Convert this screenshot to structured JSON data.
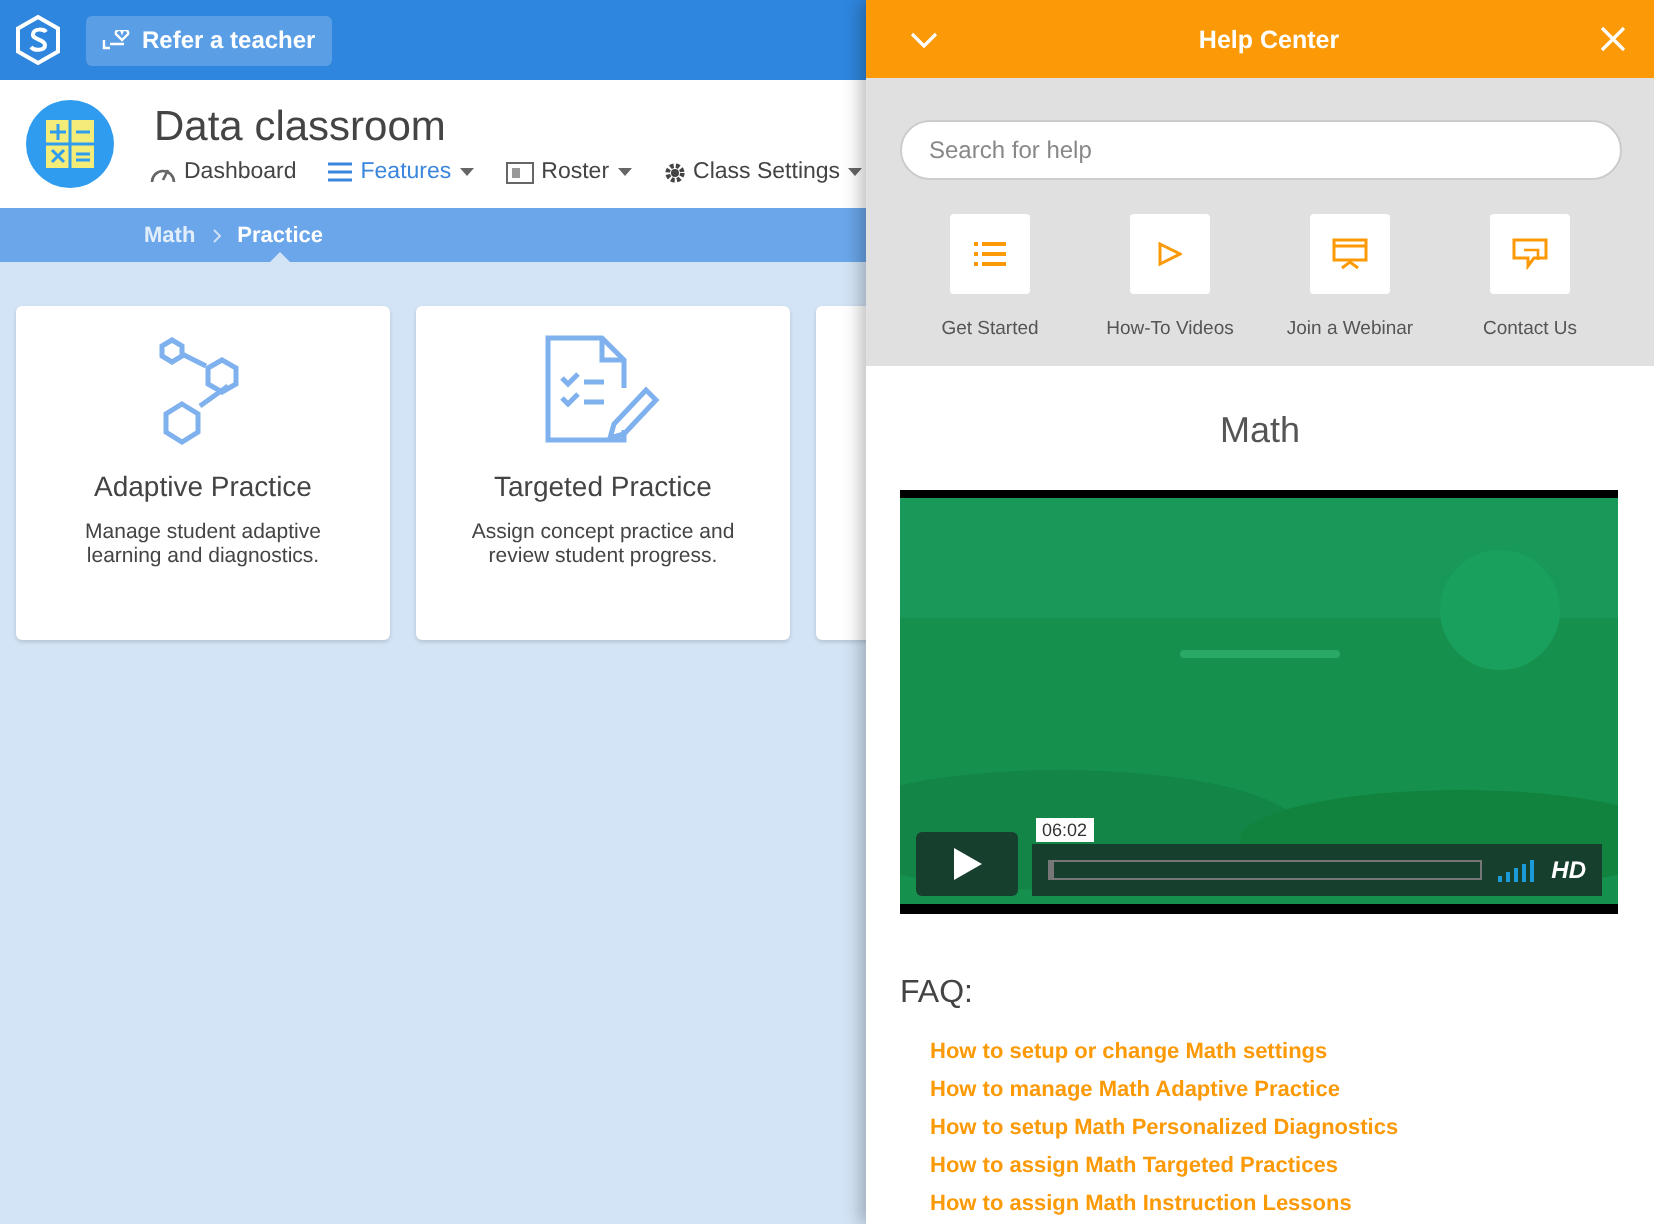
{
  "top_bar": {
    "refer_button": "Refer a teacher"
  },
  "header": {
    "title": "Data classroom",
    "nav": [
      {
        "label": "Dashboard",
        "kind": "gauge",
        "selected": false,
        "dropdown": false
      },
      {
        "label": "Features",
        "kind": "list",
        "selected": true,
        "dropdown": true
      },
      {
        "label": "Roster",
        "kind": "roster",
        "selected": false,
        "dropdown": true
      },
      {
        "label": "Class Settings",
        "kind": "gear",
        "selected": false,
        "dropdown": true
      }
    ]
  },
  "breadcrumb": [
    {
      "label": "Math",
      "selected": false
    },
    {
      "label": "Practice",
      "selected": true
    }
  ],
  "cards": [
    {
      "kind": "adaptive",
      "title": "Adaptive Practice",
      "description": "Manage student adaptive learning and diagnostics."
    },
    {
      "kind": "targeted",
      "title": "Targeted Practice",
      "description": "Assign concept practice and review student progress."
    },
    {
      "kind": "hidden"
    }
  ],
  "help_panel": {
    "title": "Help Center",
    "search": {
      "placeholder": "Search for help"
    },
    "quick_links": [
      {
        "kind": "list",
        "label": "Get Started"
      },
      {
        "kind": "play",
        "label": "How-To Videos"
      },
      {
        "kind": "webinar",
        "label": "Join a Webinar"
      },
      {
        "kind": "chat",
        "label": "Contact Us"
      }
    ],
    "section_title": "Math",
    "video": {
      "kind": "picture",
      "time_tooltip": "06:02",
      "progress": {
        "level": 0
      },
      "quality": "HD"
    },
    "faq_title": "FAQ:",
    "faq_links": [
      "How to setup or change Math settings",
      "How to manage Math Adaptive Practice",
      "How to setup Math Personalized Diagnostics",
      "How to assign Math Targeted Practices",
      "How to assign Math Instruction Lessons"
    ]
  }
}
